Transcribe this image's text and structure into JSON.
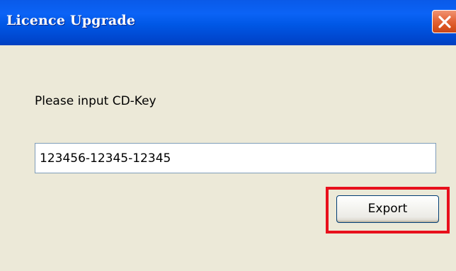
{
  "window": {
    "title": "Licence Upgrade",
    "close_icon": "close-icon"
  },
  "form": {
    "prompt_label": "Please input CD-Key",
    "cdkey_value": "123456-12345-12345",
    "export_label": "Export"
  },
  "colors": {
    "titlebar": "#0058E6",
    "dialog_background": "#ECE9D8",
    "close_button": "#E0572A",
    "highlight": "#E8101C"
  }
}
